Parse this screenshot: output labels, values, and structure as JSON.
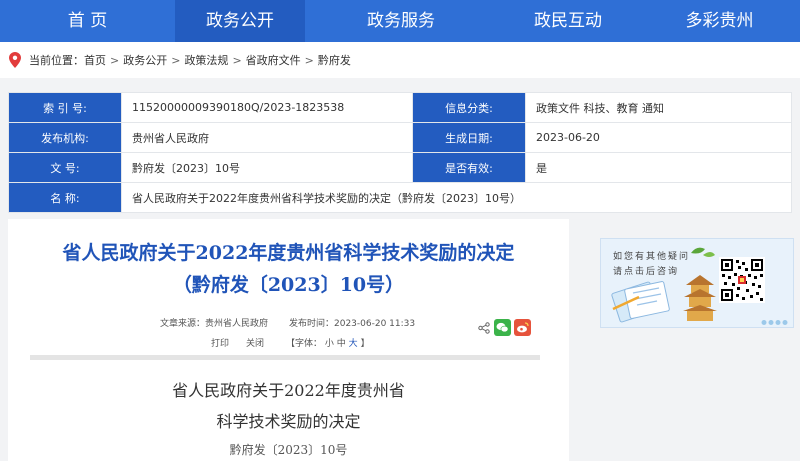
{
  "nav": {
    "items": [
      {
        "label": "首 页",
        "active": false
      },
      {
        "label": "政务公开",
        "active": true
      },
      {
        "label": "政务服务",
        "active": false
      },
      {
        "label": "政民互动",
        "active": false
      },
      {
        "label": "多彩贵州",
        "active": false
      }
    ]
  },
  "breadcrumb": {
    "prefix": "当前位置：",
    "items": [
      "首页",
      "政务公开",
      "政策法规",
      "省政府文件",
      "黔府发"
    ],
    "separator": ">"
  },
  "info": {
    "index_label": "索  引  号:",
    "index_value": "11520000009390180Q/2023-1823538",
    "category_label": "信息分类:",
    "category_value": "政策文件    科技、教育    通知",
    "issuer_label": "发布机构:",
    "issuer_value": "贵州省人民政府",
    "date_label": "生成日期:",
    "date_value": "2023-06-20",
    "docno_label": "文        号:",
    "docno_value": "黔府发〔2023〕10号",
    "valid_label": "是否有效:",
    "valid_value": "是",
    "name_label": "名        称:",
    "name_value": "省人民政府关于2022年度贵州省科学技术奖励的决定（黔府发〔2023〕10号）"
  },
  "article": {
    "title_line1": "省人民政府关于2022年度贵州省科学技术奖励的决定",
    "title_line2": "（黔府发〔2023〕10号）",
    "source": "文章来源：贵州省人民政府",
    "published": "发布时间：2023-06-20 11:33",
    "print": "打印",
    "close": "关闭",
    "font_size_prefix": "【字体：",
    "font_small": "小",
    "font_medium": "中",
    "font_large": "大",
    "font_size_suffix": "】",
    "body_title_line1": "省人民政府关于2022年度贵州省",
    "body_title_line2": "科学技术奖励的决定",
    "body_docno": "黔府发〔2023〕10号"
  },
  "side_panel": {
    "line1": "如您有其他疑问",
    "line2": "请点击后咨询"
  },
  "colors": {
    "nav_bg": "#2f6fd6",
    "nav_active": "#235cc0",
    "label_bg": "#235cc0",
    "title_blue": "#2054b8",
    "wechat_green": "#3bb34a",
    "weibo_red": "#e6533c"
  },
  "icons": {
    "location": "map-pin-icon",
    "share": "share-icon",
    "wechat": "wechat-icon",
    "weibo": "weibo-icon"
  }
}
